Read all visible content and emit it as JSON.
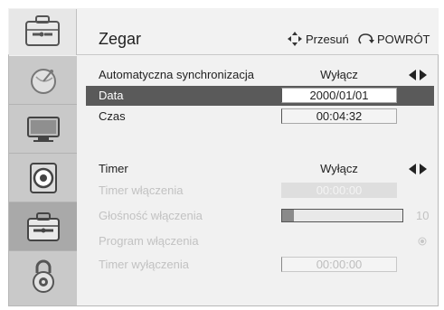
{
  "header": {
    "title": "Zegar",
    "move_hint": "Przesuń",
    "back_hint": "POWRÓT"
  },
  "sidebar": {
    "items": [
      {
        "icon": "satellite-icon",
        "active": false
      },
      {
        "icon": "tv-icon",
        "active": false
      },
      {
        "icon": "speaker-icon",
        "active": false
      },
      {
        "icon": "settings-toolbox-icon",
        "active": true
      },
      {
        "icon": "lock-icon",
        "active": false
      }
    ]
  },
  "settings": {
    "auto_sync": {
      "label": "Automatyczna synchronizacja",
      "value": "Wyłącz"
    },
    "date": {
      "label": "Data",
      "value": "2000/01/01"
    },
    "time": {
      "label": "Czas",
      "value": "00:04:32"
    },
    "timer": {
      "label": "Timer",
      "value": "Wyłącz"
    },
    "on_timer": {
      "label": "Timer włączenia",
      "value": "00:00:00"
    },
    "on_volume": {
      "label": "Głośność włączenia",
      "value": "10",
      "level": 0.1
    },
    "on_program": {
      "label": "Program włączenia"
    },
    "off_timer": {
      "label": "Timer wyłączenia",
      "value": "00:00:00"
    }
  },
  "colors": {
    "selected_row": "#5a5a5a",
    "sidebar_active": "#a9a9a9",
    "sidebar_bg": "#c9c9c9"
  }
}
